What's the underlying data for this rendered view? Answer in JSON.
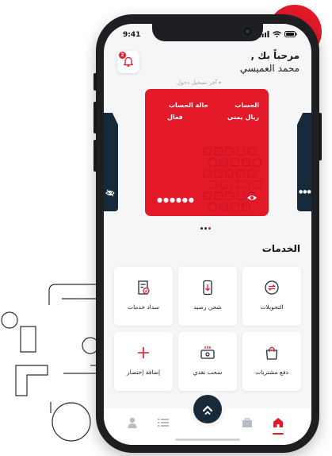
{
  "status": {
    "time": "9:41"
  },
  "header": {
    "notification_count": "2",
    "greeting": "مرحباً بك ,",
    "user_name": "محمد العميسي",
    "last_login": "آخر تسجيل دخول"
  },
  "card": {
    "account_label": "الحساب",
    "account_value": "ريال يمني",
    "status_label": "حالة الحساب",
    "status_value": "فعال",
    "masked_balance": "●●●●●●",
    "side_masked": "●●●"
  },
  "services": {
    "title": "الخدمات",
    "items": [
      {
        "label": "التحويلات",
        "icon": "transfer-icon"
      },
      {
        "label": "شحن رصيد",
        "icon": "phone-topup-icon"
      },
      {
        "label": "سداد خدمات",
        "icon": "bill-payment-icon"
      },
      {
        "label": "دفع مشتريات",
        "icon": "shopping-bag-icon"
      },
      {
        "label": "سحب نقدي",
        "icon": "cash-withdraw-icon"
      },
      {
        "label": "إضافة إختصار",
        "icon": "add-shortcut-icon"
      }
    ]
  },
  "nav": {
    "items": [
      "home-icon",
      "bag-icon",
      "menu-fab",
      "list-icon",
      "profile-icon"
    ]
  },
  "colors": {
    "accent": "#e3192a",
    "navy": "#162a3a",
    "background": "#f4f6f8"
  }
}
